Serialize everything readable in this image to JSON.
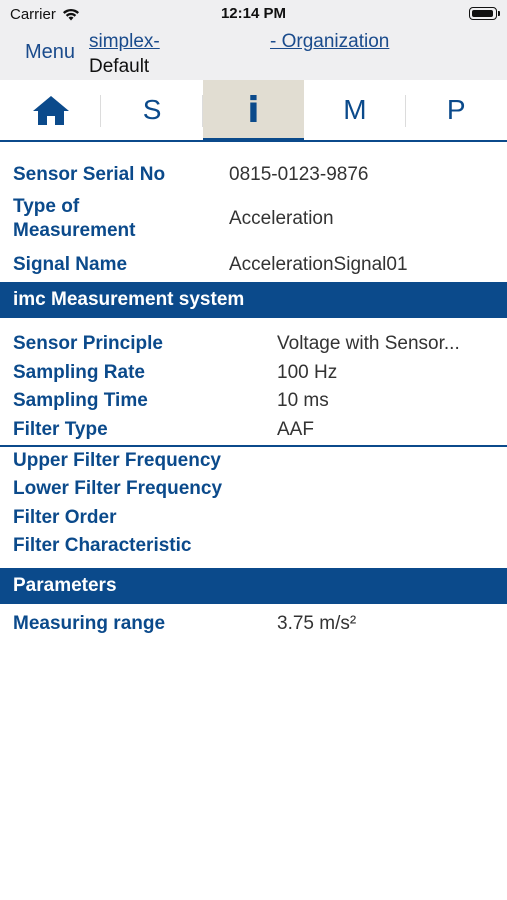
{
  "status_bar": {
    "carrier": "Carrier",
    "time": "12:14 PM"
  },
  "nav": {
    "menu": "Menu",
    "link1": "simplex-",
    "subtitle": "Default",
    "link2": "- Organization"
  },
  "tabs": [
    {
      "icon": "home-icon",
      "label": ""
    },
    {
      "label": "S"
    },
    {
      "label": "i",
      "active": true
    },
    {
      "label": "M"
    },
    {
      "label": "P"
    }
  ],
  "sensor": {
    "serial_label": "Sensor Serial No",
    "serial_value": "0815-0123-9876",
    "type_label_1": "Type of",
    "type_label_2": "Measurement",
    "type_value": "Acceleration",
    "signal_label": "Signal Name",
    "signal_value": "AccelerationSignal01"
  },
  "imc": {
    "header": "imc Measurement system",
    "rows": [
      {
        "label": "Sensor Principle",
        "value": "Voltage with Sensor..."
      },
      {
        "label": "Sampling Rate",
        "value": "100 Hz"
      },
      {
        "label": "Sampling Time",
        "value": "10 ms"
      },
      {
        "label": "Filter Type",
        "value": "AAF"
      }
    ],
    "filter_rows": [
      {
        "label": "Upper Filter Frequency"
      },
      {
        "label": "Lower Filter Frequency"
      },
      {
        "label": "Filter Order"
      },
      {
        "label": "Filter Characteristic"
      }
    ]
  },
  "parameters": {
    "header": "Parameters",
    "rows": [
      {
        "label": "Measuring range",
        "value": "3.75 m/s²"
      }
    ]
  },
  "colors": {
    "brand_blue": "#0b4a8b",
    "active_tab_bg": "#e1ddd2",
    "header_gray": "#efeff1"
  }
}
